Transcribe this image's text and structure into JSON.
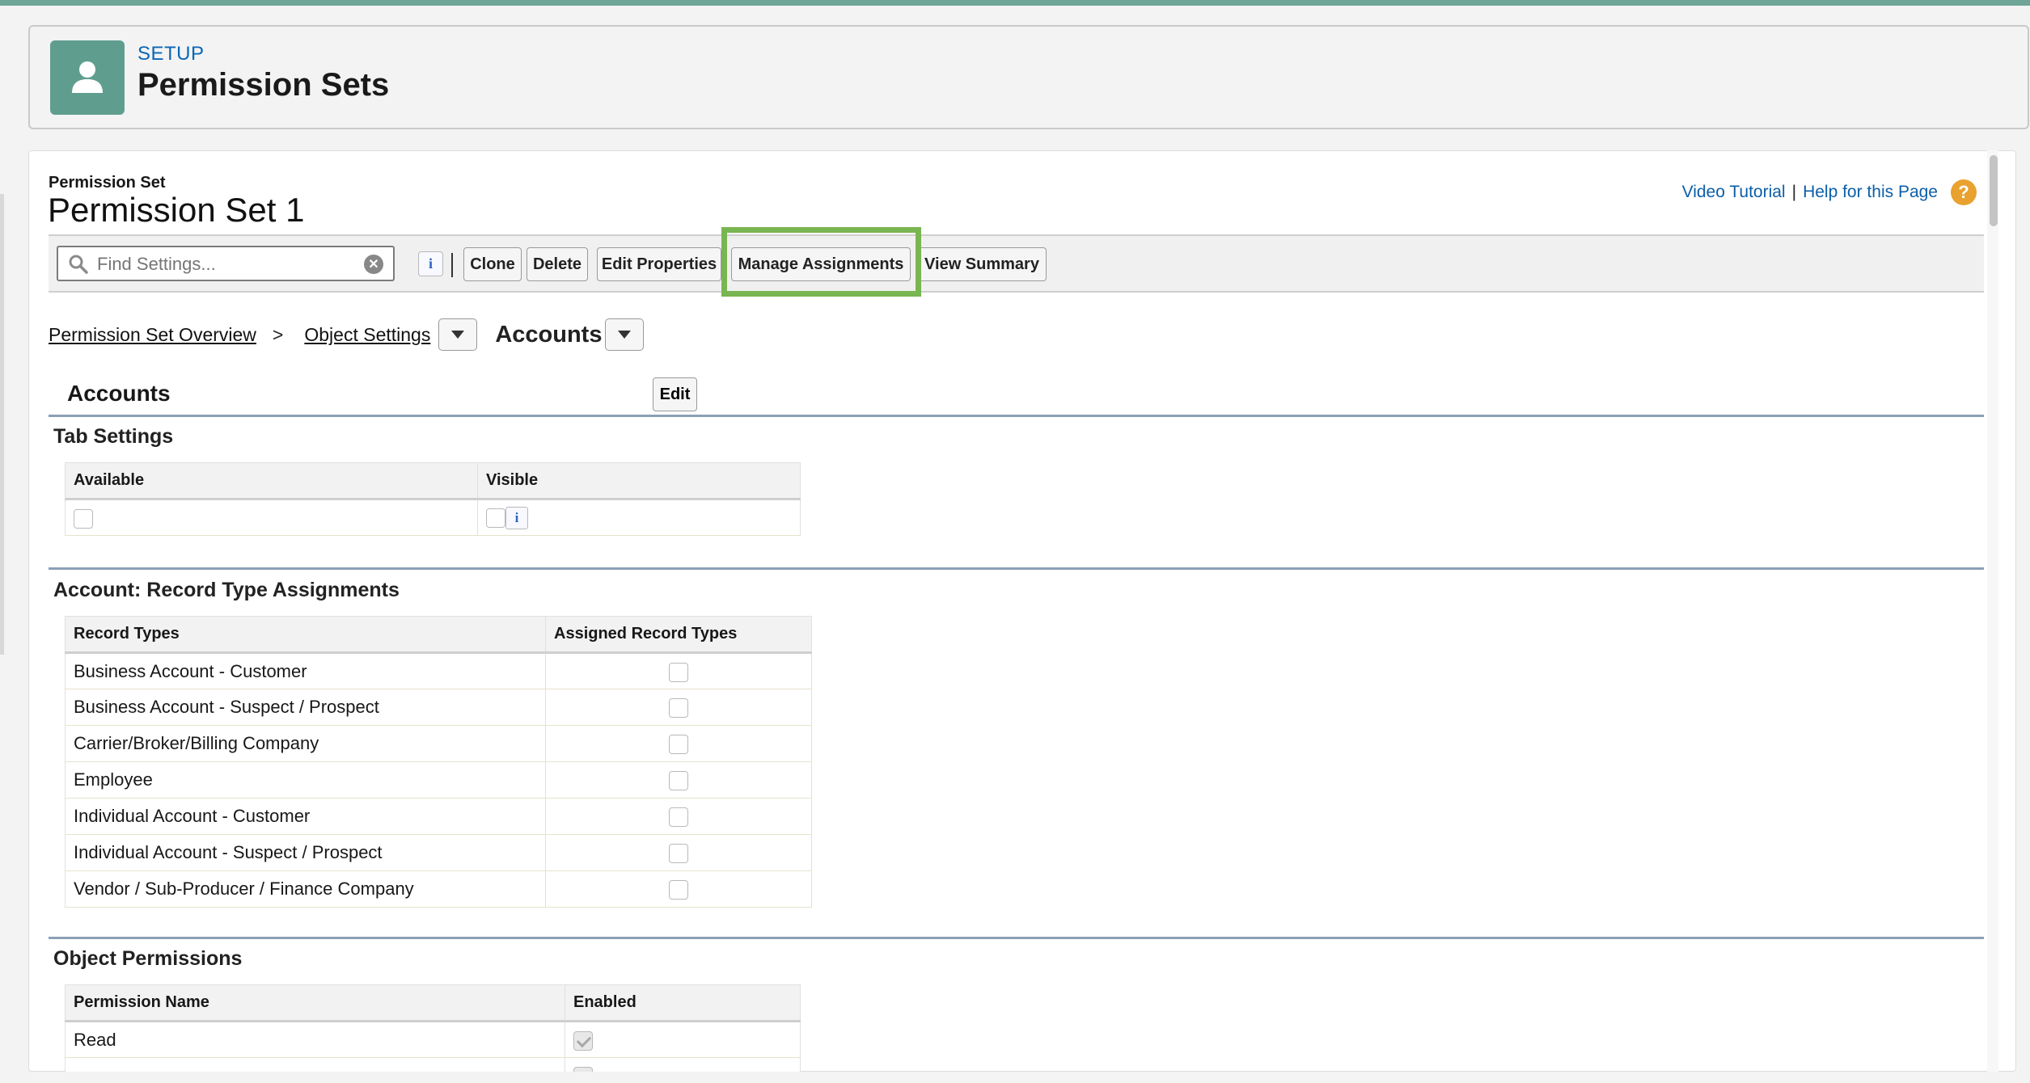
{
  "header": {
    "setup_label": "SETUP",
    "title": "Permission Sets",
    "icon": "user-icon"
  },
  "record": {
    "kind": "Permission Set",
    "title": "Permission Set 1",
    "links": {
      "video": "Video Tutorial",
      "separator": "|",
      "help": "Help for this Page"
    }
  },
  "toolbar": {
    "search_placeholder": "Find Settings...",
    "info": "i",
    "buttons": {
      "clone": "Clone",
      "delete": "Delete",
      "edit_properties": "Edit Properties",
      "manage_assignments": "Manage Assignments",
      "view_summary": "View Summary"
    }
  },
  "breadcrumb": {
    "overview": "Permission Set Overview",
    "sep": ">",
    "object_settings": "Object Settings",
    "current": "Accounts"
  },
  "object": {
    "name": "Accounts",
    "edit_label": "Edit"
  },
  "tab_settings": {
    "heading": "Tab Settings",
    "columns": [
      "Available",
      "Visible"
    ],
    "info": "i"
  },
  "record_types": {
    "heading": "Account: Record Type Assignments",
    "columns": [
      "Record Types",
      "Assigned Record Types"
    ],
    "rows": [
      "Business Account - Customer",
      "Business Account - Suspect / Prospect",
      "Carrier/Broker/Billing Company",
      "Employee",
      "Individual Account - Customer",
      "Individual Account - Suspect / Prospect",
      "Vendor / Sub-Producer / Finance Company"
    ]
  },
  "object_permissions": {
    "heading": "Object Permissions",
    "columns": [
      "Permission Name",
      "Enabled"
    ],
    "rows": [
      {
        "name": "Read",
        "enabled": true
      }
    ]
  }
}
